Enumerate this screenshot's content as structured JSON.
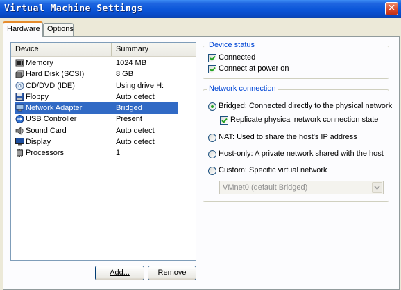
{
  "window": {
    "title": "Virtual Machine Settings",
    "close_glyph": "✕"
  },
  "tabs": [
    {
      "label": "Hardware",
      "active": true
    },
    {
      "label": "Options",
      "active": false
    }
  ],
  "device_list": {
    "columns": [
      "Device",
      "Summary"
    ],
    "rows": [
      {
        "icon": "memory-icon",
        "name": "Memory",
        "summary": "1024 MB",
        "selected": false
      },
      {
        "icon": "hard-disk-icon",
        "name": "Hard Disk (SCSI)",
        "summary": "8 GB",
        "selected": false
      },
      {
        "icon": "cd-dvd-icon",
        "name": "CD/DVD (IDE)",
        "summary": "Using drive H:",
        "selected": false
      },
      {
        "icon": "floppy-icon",
        "name": "Floppy",
        "summary": "Auto detect",
        "selected": false
      },
      {
        "icon": "network-adapter-icon",
        "name": "Network Adapter",
        "summary": "Bridged",
        "selected": true
      },
      {
        "icon": "usb-controller-icon",
        "name": "USB Controller",
        "summary": "Present",
        "selected": false
      },
      {
        "icon": "sound-card-icon",
        "name": "Sound Card",
        "summary": "Auto detect",
        "selected": false
      },
      {
        "icon": "display-icon",
        "name": "Display",
        "summary": "Auto detect",
        "selected": false
      },
      {
        "icon": "processors-icon",
        "name": "Processors",
        "summary": "1",
        "selected": false
      }
    ]
  },
  "buttons": {
    "add": "Add...",
    "remove": "Remove"
  },
  "device_status": {
    "legend": "Device status",
    "connected": {
      "label": "Connected",
      "checked": true
    },
    "connect_at_power_on": {
      "label": "Connect at power on",
      "checked": true
    }
  },
  "network_connection": {
    "legend": "Network connection",
    "bridged": {
      "label": "Bridged: Connected directly to the physical network",
      "selected": true
    },
    "replicate": {
      "label": "Replicate physical network connection state",
      "checked": true
    },
    "nat": {
      "label": "NAT: Used to share the host's IP address",
      "selected": false
    },
    "host_only": {
      "label": "Host-only: A private network shared with the host",
      "selected": false
    },
    "custom": {
      "label": "Custom: Specific virtual network",
      "selected": false
    },
    "custom_network_value": "VMnet0 (default Bridged)"
  },
  "colors": {
    "title_bar": "#0a55d8",
    "selection": "#316ac5",
    "group_legend": "#0046d5",
    "tab_highlight": "#e68b2c"
  }
}
